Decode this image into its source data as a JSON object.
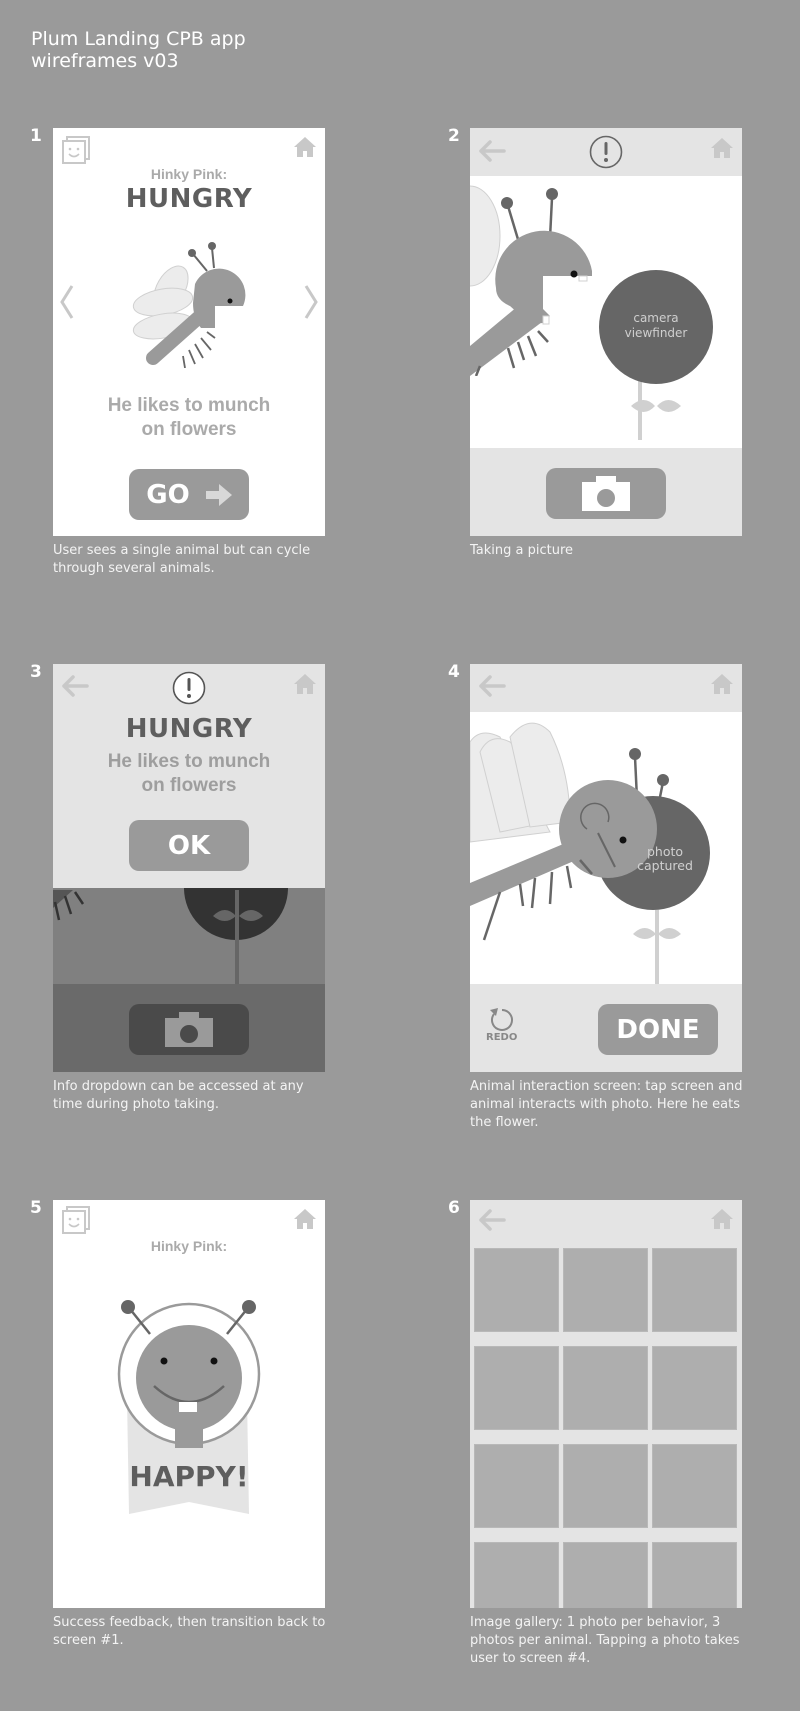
{
  "document": {
    "title_line1": "Plum Landing CPB app",
    "title_line2": "wireframes v03"
  },
  "colors": {
    "background": "#9a9a9a",
    "screen_white": "#ffffff",
    "bar_gray": "#e4e4e4",
    "button_gray": "#9a9a9a",
    "viewfinder": "#666666",
    "text_dark": "#5e5e5e",
    "text_light": "#aaaaaa"
  },
  "screens": [
    {
      "number": "1",
      "subtitle": "Hinky Pink:",
      "behavior": "HUNGRY",
      "desc_line1": "He likes to munch",
      "desc_line2": "on flowers",
      "button": "GO",
      "icons": [
        "gallery-icon",
        "home-icon",
        "chevron-left-icon",
        "chevron-right-icon",
        "arrow-right-icon"
      ],
      "caption": "User sees a single animal but can cycle through several animals."
    },
    {
      "number": "2",
      "viewfinder_line1": "camera",
      "viewfinder_line2": "viewfinder",
      "icons": [
        "back-arrow-icon",
        "info-icon",
        "home-icon",
        "camera-icon"
      ],
      "caption": "Taking a picture"
    },
    {
      "number": "3",
      "behavior": "HUNGRY",
      "desc_line1": "He likes to munch",
      "desc_line2": "on flowers",
      "button": "OK",
      "icons": [
        "back-arrow-icon",
        "info-icon",
        "home-icon",
        "camera-icon"
      ],
      "caption": "Info dropdown can be accessed at any time during photo taking."
    },
    {
      "number": "4",
      "photo_line1": "photo",
      "photo_line2": "captured",
      "redo_label": "REDO",
      "button": "DONE",
      "icons": [
        "back-arrow-icon",
        "home-icon",
        "redo-icon"
      ],
      "caption": "Animal interaction screen: tap screen and animal interacts with photo. Here he eats the flower."
    },
    {
      "number": "5",
      "subtitle": "Hinky Pink:",
      "badge": "HAPPY!",
      "icons": [
        "gallery-icon",
        "home-icon"
      ],
      "caption": "Success feedback, then transition back to screen #1."
    },
    {
      "number": "6",
      "gallery_rows": 4,
      "gallery_cols": 3,
      "icons": [
        "back-arrow-icon",
        "home-icon"
      ],
      "caption": "Image gallery: 1 photo per behavior, 3 photos per animal. Tapping a photo takes user to screen #4."
    }
  ]
}
